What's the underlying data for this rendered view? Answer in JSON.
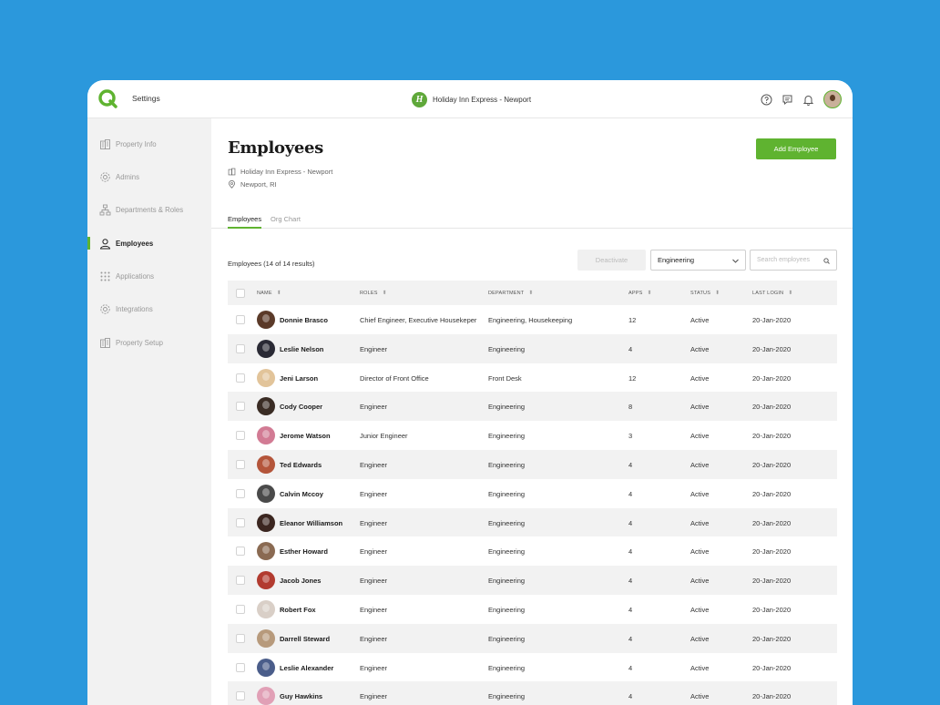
{
  "topbar": {
    "title": "Settings",
    "property_name": "Holiday Inn Express - Newport",
    "property_logo": "H"
  },
  "sidebar": {
    "items": [
      {
        "label": "Property Info",
        "icon": "building-icon"
      },
      {
        "label": "Admins",
        "icon": "gear-icon"
      },
      {
        "label": "Departments & Roles",
        "icon": "org-chart-icon"
      },
      {
        "label": "Employees",
        "icon": "user-icon",
        "active": true
      },
      {
        "label": "Applications",
        "icon": "grid-icon"
      },
      {
        "label": "Integrations",
        "icon": "gear-icon"
      },
      {
        "label": "Property Setup",
        "icon": "building-icon"
      }
    ]
  },
  "main": {
    "title": "Employees",
    "property": "Holiday Inn Express - Newport",
    "location": "Newport, RI",
    "add_button": "Add Employee",
    "tabs": [
      "Employees",
      "Org Chart"
    ],
    "results_label": "Employees (14 of 14 results)",
    "deactivate_button": "Deactivate",
    "department_filter": "Engineering",
    "search_placeholder": "Search employees"
  },
  "table": {
    "columns": [
      "NAME",
      "ROLES",
      "DEPARTMENT",
      "APPS",
      "STATUS",
      "LAST LOGIN"
    ],
    "rows": [
      {
        "name": "Donnie Brasco",
        "roles": "Chief Engineer, Executive Housekeper",
        "department": "Engineering, Housekeeping",
        "apps": "12",
        "status": "Active",
        "last_login": "20-Jan-2020",
        "avatar_color": "#5b3a29"
      },
      {
        "name": "Leslie Nelson",
        "roles": "Engineer",
        "department": "Engineering",
        "apps": "4",
        "status": "Active",
        "last_login": "20-Jan-2020",
        "avatar_color": "#2a2a35"
      },
      {
        "name": "Jeni Larson",
        "roles": "Director of Front Office",
        "department": "Front Desk",
        "apps": "12",
        "status": "Active",
        "last_login": "20-Jan-2020",
        "avatar_color": "#e2c49a"
      },
      {
        "name": "Cody Cooper",
        "roles": "Engineer",
        "department": "Engineering",
        "apps": "8",
        "status": "Active",
        "last_login": "20-Jan-2020",
        "avatar_color": "#3a2c24"
      },
      {
        "name": "Jerome Watson",
        "roles": "Junior Engineer",
        "department": "Engineering",
        "apps": "3",
        "status": "Active",
        "last_login": "20-Jan-2020",
        "avatar_color": "#d27b94"
      },
      {
        "name": "Ted Edwards",
        "roles": "Engineer",
        "department": "Engineering",
        "apps": "4",
        "status": "Active",
        "last_login": "20-Jan-2020",
        "avatar_color": "#b4553a"
      },
      {
        "name": "Calvin Mccoy",
        "roles": "Engineer",
        "department": "Engineering",
        "apps": "4",
        "status": "Active",
        "last_login": "20-Jan-2020",
        "avatar_color": "#4a4a4a"
      },
      {
        "name": "Eleanor Williamson",
        "roles": "Engineer",
        "department": "Engineering",
        "apps": "4",
        "status": "Active",
        "last_login": "20-Jan-2020",
        "avatar_color": "#3b2620"
      },
      {
        "name": "Esther Howard",
        "roles": "Engineer",
        "department": "Engineering",
        "apps": "4",
        "status": "Active",
        "last_login": "20-Jan-2020",
        "avatar_color": "#8a6a52"
      },
      {
        "name": "Jacob Jones",
        "roles": "Engineer",
        "department": "Engineering",
        "apps": "4",
        "status": "Active",
        "last_login": "20-Jan-2020",
        "avatar_color": "#b23b2f"
      },
      {
        "name": "Robert Fox",
        "roles": "Engineer",
        "department": "Engineering",
        "apps": "4",
        "status": "Active",
        "last_login": "20-Jan-2020",
        "avatar_color": "#d9cfc7"
      },
      {
        "name": "Darrell Steward",
        "roles": "Engineer",
        "department": "Engineering",
        "apps": "4",
        "status": "Active",
        "last_login": "20-Jan-2020",
        "avatar_color": "#b79a7c"
      },
      {
        "name": "Leslie Alexander",
        "roles": "Engineer",
        "department": "Engineering",
        "apps": "4",
        "status": "Active",
        "last_login": "20-Jan-2020",
        "avatar_color": "#4a5d8a"
      },
      {
        "name": "Guy Hawkins",
        "roles": "Engineer",
        "department": "Engineering",
        "apps": "4",
        "status": "Active",
        "last_login": "20-Jan-2020",
        "avatar_color": "#e1a0b6"
      }
    ]
  },
  "colors": {
    "background": "#2b98dc",
    "accent": "#5fb330",
    "sidebar": "#f2f2f2"
  }
}
